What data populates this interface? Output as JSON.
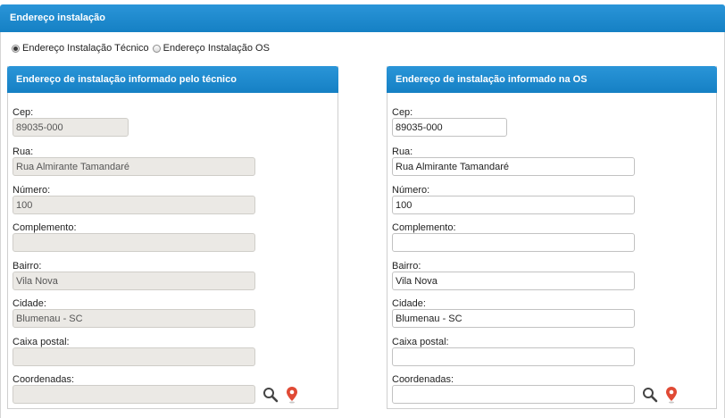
{
  "header": {
    "title": "Endereço instalação"
  },
  "selector": {
    "options": [
      {
        "label": "Endereço Instalação Técnico",
        "checked": true
      },
      {
        "label": "Endereço Instalação OS",
        "checked": false
      }
    ]
  },
  "tecnico": {
    "title": "Endereço de instalação informado pelo técnico",
    "fields": {
      "cep": {
        "label": "Cep:",
        "value": "89035-000"
      },
      "rua": {
        "label": "Rua:",
        "value": "Rua Almirante Tamandaré"
      },
      "numero": {
        "label": "Número:",
        "value": "100"
      },
      "complemento": {
        "label": "Complemento:",
        "value": ""
      },
      "bairro": {
        "label": "Bairro:",
        "value": "Vila Nova"
      },
      "cidade": {
        "label": "Cidade:",
        "value": "Blumenau - SC"
      },
      "caixa_postal": {
        "label": "Caixa postal:",
        "value": ""
      },
      "coordenadas": {
        "label": "Coordenadas:",
        "value": ""
      }
    }
  },
  "os": {
    "title": "Endereço de instalação informado na OS",
    "fields": {
      "cep": {
        "label": "Cep:",
        "value": "89035-000"
      },
      "rua": {
        "label": "Rua:",
        "value": "Rua Almirante Tamandaré"
      },
      "numero": {
        "label": "Número:",
        "value": "100"
      },
      "complemento": {
        "label": "Complemento:",
        "value": ""
      },
      "bairro": {
        "label": "Bairro:",
        "value": "Vila Nova"
      },
      "cidade": {
        "label": "Cidade:",
        "value": "Blumenau - SC"
      },
      "caixa_postal": {
        "label": "Caixa postal:",
        "value": ""
      },
      "coordenadas": {
        "label": "Coordenadas:",
        "value": ""
      }
    }
  },
  "icons": {
    "search": "search-icon",
    "map_pin": "map-pin-icon"
  },
  "colors": {
    "header_blue": "#1a88cf",
    "pin_red": "#e04a35",
    "readonly_bg": "#ebe9e5"
  }
}
